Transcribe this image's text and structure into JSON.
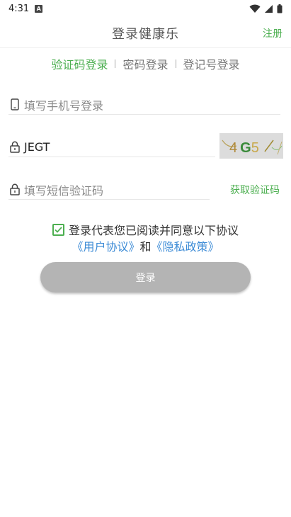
{
  "status_bar": {
    "time": "4:31",
    "notification_icon": "A"
  },
  "header": {
    "title": "登录健康乐",
    "register_label": "注册"
  },
  "tabs": [
    {
      "label": "验证码登录",
      "active": true
    },
    {
      "label": "密码登录",
      "active": false
    },
    {
      "label": "登记号登录",
      "active": false
    }
  ],
  "phone_field": {
    "placeholder": "填写手机号登录",
    "icon": "phone-icon"
  },
  "captcha_field": {
    "value": "JEGT",
    "icon": "lock-icon",
    "captcha_text": "4G5"
  },
  "sms_field": {
    "placeholder": "填写短信验证码",
    "icon": "lock-icon",
    "get_code_label": "获取验证码"
  },
  "agreement": {
    "checked": true,
    "text": "登录代表您已阅读并同意以下协议",
    "user_agreement": "《用户协议》",
    "and": "和",
    "privacy_policy": "《隐私政策》"
  },
  "login_button": {
    "label": "登录"
  },
  "colors": {
    "accent": "#4caf50",
    "link": "#3c8bd6",
    "button_disabled": "#b4b4b4"
  }
}
